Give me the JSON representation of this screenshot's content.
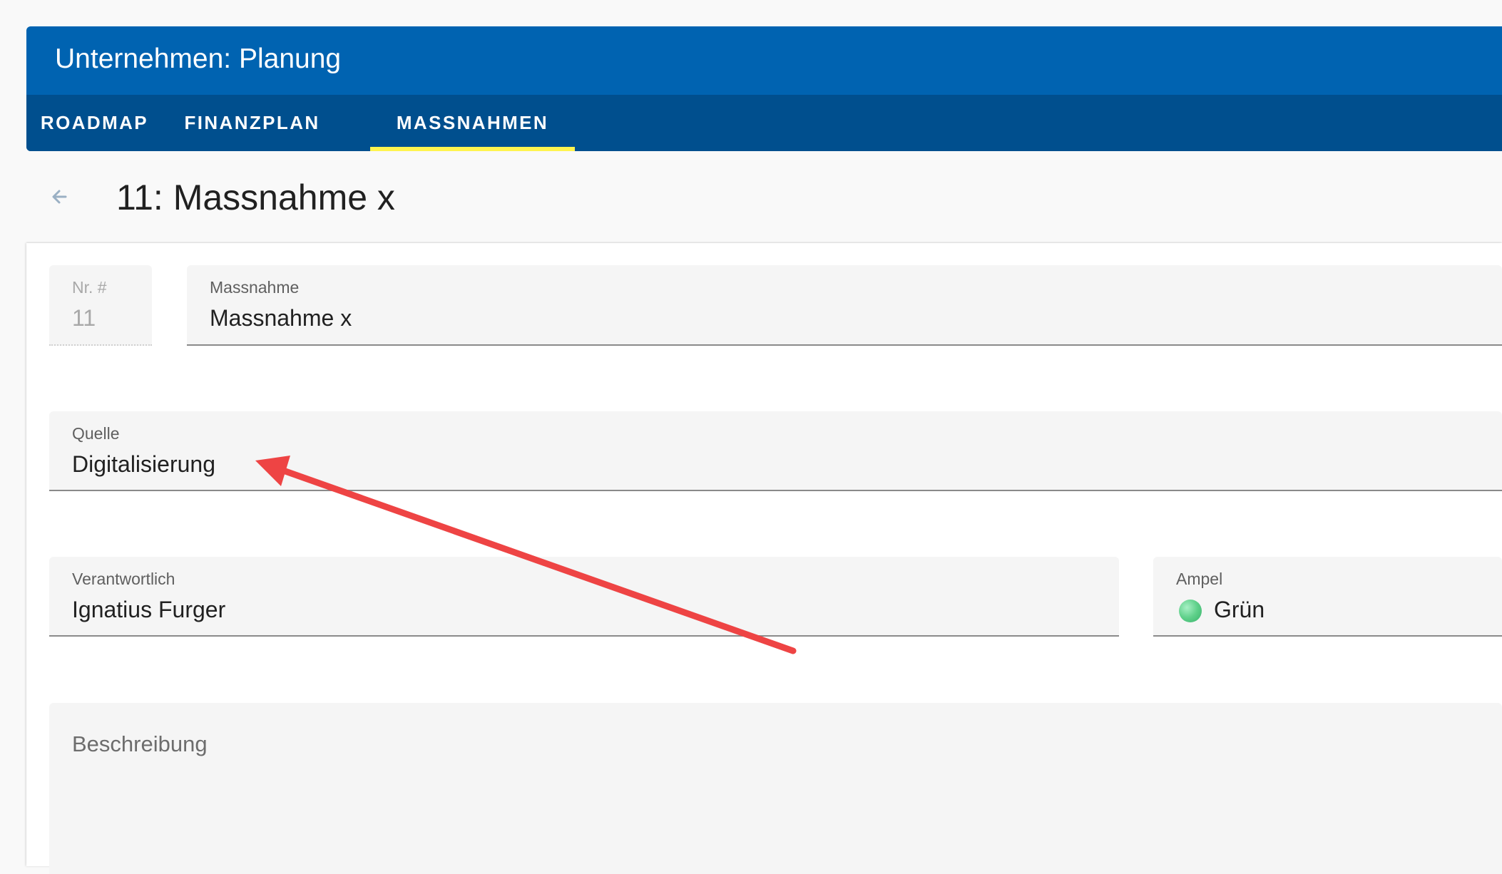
{
  "header": {
    "title": "Unternehmen: Planung"
  },
  "tabs": [
    {
      "label": "ROADMAP",
      "active": false
    },
    {
      "label": "FINANZPLAN",
      "active": false
    },
    {
      "label": "MASSNAHMEN",
      "active": true
    }
  ],
  "page": {
    "back_icon": "arrow-left-icon",
    "title": "11: Massnahme x"
  },
  "form": {
    "nr": {
      "label": "Nr. #",
      "value": "11",
      "disabled": true
    },
    "massnahme": {
      "label": "Massnahme",
      "value": "Massnahme x"
    },
    "quelle": {
      "label": "Quelle",
      "value": "Digitalisierung"
    },
    "verantwortlich": {
      "label": "Verantwortlich",
      "value": "Ignatius Furger"
    },
    "ampel": {
      "label": "Ampel",
      "value": "Grün",
      "status_color": "#5fd08a"
    },
    "beschreibung": {
      "label": "Beschreibung",
      "value": ""
    }
  },
  "colors": {
    "header": "#0063b1",
    "tabbar": "#004f8e",
    "tab_indicator": "#fff44f",
    "annotation_arrow": "#ee4444"
  }
}
